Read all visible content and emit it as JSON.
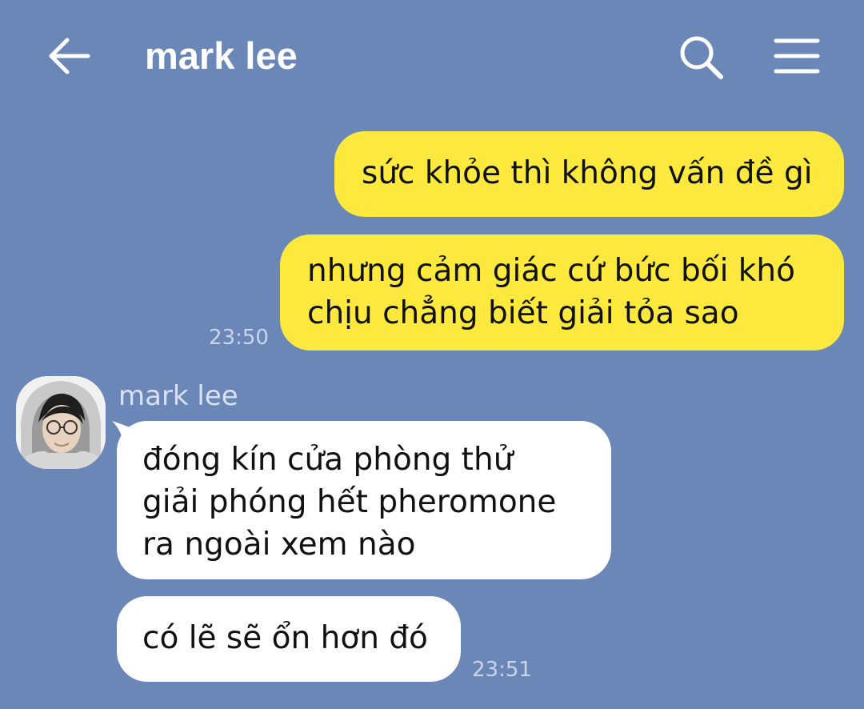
{
  "header": {
    "title": "mark lee",
    "back_icon": "arrow-left-icon",
    "search_icon": "search-icon",
    "menu_icon": "hamburger-menu-icon"
  },
  "colors": {
    "background": "#6b87b7",
    "outgoing_bubble": "#fde93d",
    "incoming_bubble": "#ffffff",
    "text": "#111111"
  },
  "messages": [
    {
      "direction": "outgoing",
      "lines": [
        "sức khỏe thì không vấn đề gì"
      ]
    },
    {
      "direction": "outgoing",
      "lines": [
        "nhưng cảm giác cứ bức bối khó",
        "chịu chẳng biết giải tỏa sao"
      ],
      "time": "23:50"
    },
    {
      "direction": "incoming",
      "sender": "mark lee",
      "lines": [
        "đóng kín cửa phòng thử",
        "giải phóng hết pheromone",
        "ra ngoài xem nào"
      ]
    },
    {
      "direction": "incoming",
      "lines": [
        "có lẽ sẽ ổn hơn đó"
      ],
      "time": "23:51"
    }
  ]
}
